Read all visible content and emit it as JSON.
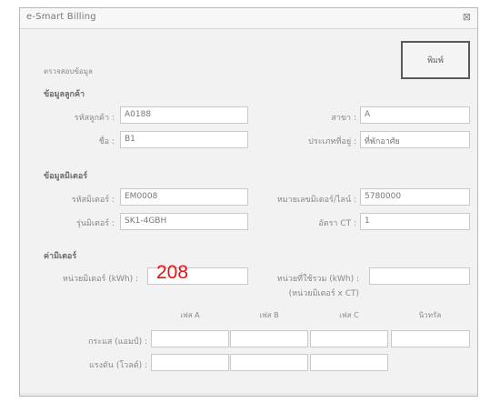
{
  "window": {
    "title": "e-Smart Billing",
    "close_glyph": "⊠"
  },
  "toolbar": {
    "print_label": "พิมพ์"
  },
  "caption": "ตรวจสอบข้อมูล",
  "customer": {
    "section_label": "ข้อมูลลูกค้า",
    "fields": [
      {
        "label": "รหัสลูกค้า :",
        "value": "A0188"
      },
      {
        "label": "สาขา :",
        "value": "A"
      },
      {
        "label": "ชื่อ :",
        "value": "B1"
      },
      {
        "label": "ประเภทที่อยู่ :",
        "value": "ที่พักอาศัย"
      }
    ]
  },
  "meter": {
    "section_label": "ข้อมูลมิเตอร์",
    "fields": [
      {
        "label": "รหัสมิเตอร์ :",
        "value": "EM0008"
      },
      {
        "label": "หมายเลขมิเตอร์/ไลน์ :",
        "value": "5780000"
      },
      {
        "label": "รุ่นมิเตอร์ :",
        "value": "SK1-4GBH"
      },
      {
        "label": "อัตรา CT :",
        "value": "1"
      }
    ]
  },
  "reading": {
    "section_label": "ค่ามิเตอร์",
    "current_label": "หน่วยมิเตอร์ (kWh) :",
    "current_value": "208",
    "total_label": "หน่วยที่ใช้รวม (kWh) :",
    "total_sublabel": "(หน่วยมิเตอร์ x CT)",
    "total_value": ""
  },
  "phases": {
    "columns": [
      "เฟส A",
      "เฟส B",
      "เฟส C",
      "นิวทรัล"
    ],
    "rows": [
      {
        "label": "กระแส (แอมป์) :",
        "values": [
          "",
          "",
          "",
          ""
        ]
      },
      {
        "label": "แรงดัน (โวลต์) :",
        "values": [
          "",
          "",
          ""
        ]
      }
    ]
  }
}
